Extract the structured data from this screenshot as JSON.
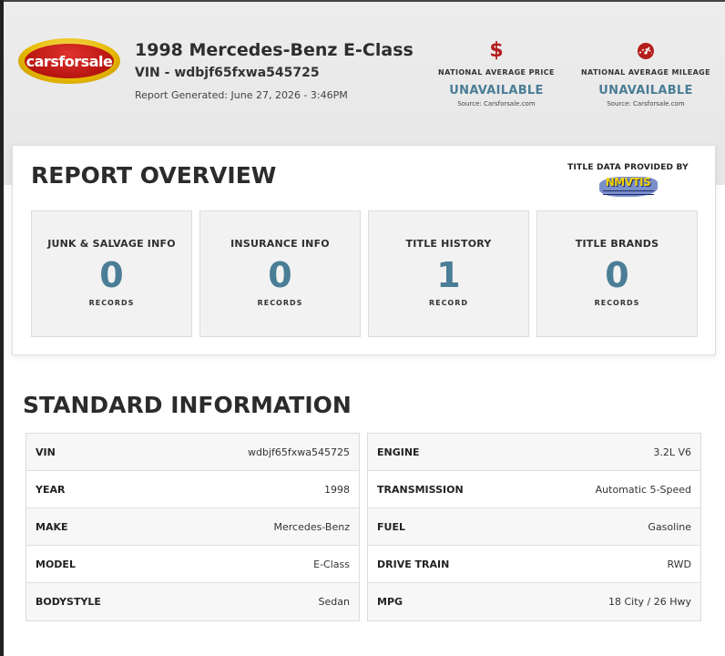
{
  "header": {
    "logo_text": "carsforsale",
    "vehicle_title": "1998 Mercedes-Benz E-Class",
    "vin_line": "VIN - wdbjf65fxwa545725",
    "report_generated": "Report Generated: June 27, 2026 - 3:46PM",
    "stats": [
      {
        "icon": "dollar-icon",
        "label": "NATIONAL AVERAGE PRICE",
        "value": "UNAVAILABLE",
        "source": "Source: Carsforsale.com"
      },
      {
        "icon": "speedometer-icon",
        "label": "NATIONAL AVERAGE MILEAGE",
        "value": "UNAVAILABLE",
        "source": "Source: Carsforsale.com"
      }
    ]
  },
  "overview": {
    "title": "REPORT OVERVIEW",
    "title_data_label": "TITLE DATA PROVIDED BY",
    "nmvtis_logo_text": "NMVTIS",
    "boxes": [
      {
        "title": "JUNK & SALVAGE INFO",
        "count": "0",
        "unit": "RECORDS"
      },
      {
        "title": "INSURANCE INFO",
        "count": "0",
        "unit": "RECORDS"
      },
      {
        "title": "TITLE HISTORY",
        "count": "1",
        "unit": "RECORD"
      },
      {
        "title": "TITLE BRANDS",
        "count": "0",
        "unit": "RECORDS"
      }
    ]
  },
  "standard": {
    "title": "STANDARD INFORMATION",
    "left": [
      {
        "key": "VIN",
        "value": "wdbjf65fxwa545725"
      },
      {
        "key": "YEAR",
        "value": "1998"
      },
      {
        "key": "MAKE",
        "value": "Mercedes-Benz"
      },
      {
        "key": "MODEL",
        "value": "E-Class"
      },
      {
        "key": "BODYSTYLE",
        "value": "Sedan"
      }
    ],
    "right": [
      {
        "key": "ENGINE",
        "value": "3.2L V6"
      },
      {
        "key": "TRANSMISSION",
        "value": "Automatic 5-Speed"
      },
      {
        "key": "FUEL",
        "value": "Gasoline"
      },
      {
        "key": "DRIVE TRAIN",
        "value": "RWD"
      },
      {
        "key": "MPG",
        "value": "18 City / 26 Hwy"
      }
    ]
  },
  "colors": {
    "accent_blue": "#4a7d96",
    "brand_red": "#b51c1c",
    "brand_gold": "#e6b800"
  }
}
